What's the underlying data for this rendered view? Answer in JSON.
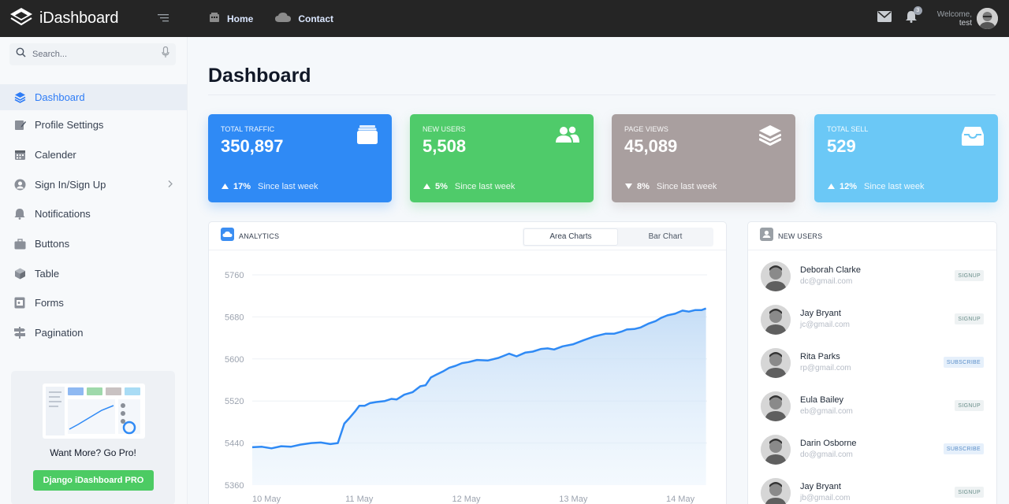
{
  "topbar": {
    "brand": "iDashboard",
    "nav": [
      {
        "label": "Home",
        "icon": "building-icon"
      },
      {
        "label": "Contact",
        "icon": "cloud-icon"
      }
    ],
    "notification_count": "3",
    "welcome_label": "Welcome,",
    "username": "test"
  },
  "sidebar": {
    "search_placeholder": "Search...",
    "items": [
      {
        "label": "Dashboard",
        "icon": "layers-icon",
        "active": true
      },
      {
        "label": "Profile Settings",
        "icon": "edit-icon"
      },
      {
        "label": "Calender",
        "icon": "calendar-icon"
      },
      {
        "label": "Sign In/Sign Up",
        "icon": "user-circle-icon",
        "has_submenu": true
      },
      {
        "label": "Notifications",
        "icon": "bell-icon"
      },
      {
        "label": "Buttons",
        "icon": "briefcase-icon"
      },
      {
        "label": "Table",
        "icon": "cube-icon"
      },
      {
        "label": "Forms",
        "icon": "form-icon"
      },
      {
        "label": "Pagination",
        "icon": "signpost-icon"
      }
    ],
    "promo": {
      "title": "Want More? Go Pro!",
      "button": "Django iDashboard PRO"
    }
  },
  "page": {
    "title": "Dashboard"
  },
  "stats": [
    {
      "label": "TOTAL TRAFFIC",
      "value": "350,897",
      "change": "17%",
      "direction": "up",
      "since": "Since last week",
      "color": "#2f8af5",
      "icon": "wallet-icon"
    },
    {
      "label": "NEW USERS",
      "value": "5,508",
      "change": "5%",
      "direction": "up",
      "since": "Since last week",
      "color": "#4fcb6a",
      "icon": "users-icon"
    },
    {
      "label": "PAGE VIEWS",
      "value": "45,089",
      "change": "8%",
      "direction": "down",
      "since": "Since last week",
      "color": "#a99f9f",
      "icon": "stack-icon"
    },
    {
      "label": "TOTAL SELL",
      "value": "529",
      "change": "12%",
      "direction": "up",
      "since": "Since last week",
      "color": "#6bc8f6",
      "icon": "inbox-icon"
    }
  ],
  "analytics": {
    "header": "ANALYTICS",
    "tabs": [
      "Area Charts",
      "Bar Chart"
    ],
    "active_tab": "Area Charts"
  },
  "chart_data": {
    "type": "area",
    "title": "",
    "xlabel": "",
    "ylabel": "",
    "y_ticks": [
      5760,
      5680,
      5600,
      5520,
      5440,
      5360
    ],
    "x_ticks": [
      "10 May",
      "11 May",
      "12 May",
      "13 May",
      "14 May"
    ],
    "ylim": [
      5360,
      5760
    ],
    "xlim": [
      0,
      4.25
    ],
    "series": [
      {
        "color": "#2f8af5",
        "x": [
          0,
          0.09,
          0.18,
          0.27,
          0.36,
          0.45,
          0.55,
          0.64,
          0.73,
          0.8,
          0.86,
          0.91,
          0.96,
          1.0,
          1.05,
          1.1,
          1.16,
          1.24,
          1.3,
          1.35,
          1.42,
          1.5,
          1.57,
          1.62,
          1.67,
          1.72,
          1.78,
          1.84,
          1.9,
          1.96,
          2.02,
          2.1,
          2.2,
          2.3,
          2.4,
          2.47,
          2.55,
          2.62,
          2.7,
          2.76,
          2.82,
          2.9,
          3.0,
          3.1,
          3.2,
          3.3,
          3.38,
          3.45,
          3.5,
          3.57,
          3.63,
          3.7,
          3.77,
          3.82,
          3.88,
          3.95,
          4.02,
          4.08,
          4.14,
          4.2,
          4.24
        ],
        "values": [
          5432,
          5433,
          5430,
          5434,
          5433,
          5437,
          5440,
          5441,
          5438,
          5440,
          5477,
          5488,
          5500,
          5511,
          5511,
          5516,
          5518,
          5520,
          5524,
          5523,
          5532,
          5537,
          5548,
          5550,
          5565,
          5570,
          5576,
          5583,
          5587,
          5592,
          5594,
          5598,
          5597,
          5602,
          5610,
          5605,
          5612,
          5614,
          5619,
          5620,
          5618,
          5624,
          5628,
          5636,
          5643,
          5648,
          5648,
          5652,
          5656,
          5657,
          5660,
          5667,
          5672,
          5678,
          5683,
          5686,
          5692,
          5690,
          5693,
          5693,
          5696
        ]
      }
    ],
    "grid": true
  },
  "new_users": {
    "header": "NEW USERS",
    "users": [
      {
        "name": "Deborah Clarke",
        "email": "dc@gmail.com",
        "action": "SIGNUP"
      },
      {
        "name": "Jay Bryant",
        "email": "jc@gmail.com",
        "action": "SIGNUP"
      },
      {
        "name": "Rita Parks",
        "email": "rp@gmail.com",
        "action": "SUBSCRIBE"
      },
      {
        "name": "Eula Bailey",
        "email": "eb@gmail.com",
        "action": "SIGNUP"
      },
      {
        "name": "Darin Osborne",
        "email": "do@gmail.com",
        "action": "SUBSCRIBE"
      },
      {
        "name": "Jay Bryant",
        "email": "jb@gmail.com",
        "action": "SIGNUP"
      }
    ]
  }
}
